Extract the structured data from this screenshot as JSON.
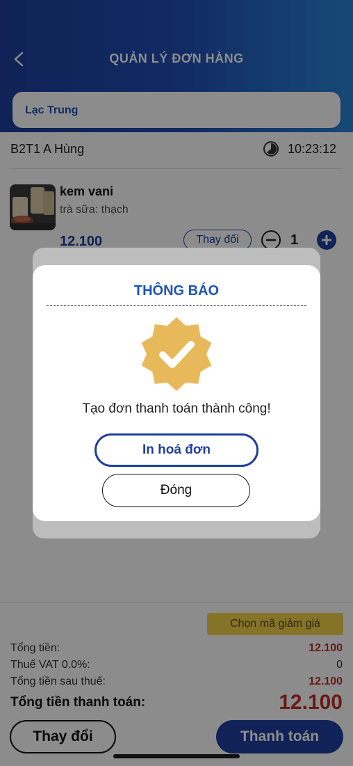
{
  "header": {
    "title": "QUẢN LÝ ĐƠN HÀNG"
  },
  "store": {
    "name": "Lạc Trung"
  },
  "order": {
    "table": "B2T1  A Hùng",
    "time": "10:23:12"
  },
  "item": {
    "name": "kem vani",
    "option": "trà sữa: thạch",
    "price": "12.100",
    "change_label": "Thay đổi",
    "quantity": "1"
  },
  "summary": {
    "discount_label": "Chọn mã giảm giá",
    "total_label": "Tổng tiền:",
    "total_value": "12.100",
    "vat_label": "Thuế VAT 0.0%:",
    "vat_value": "0",
    "after_tax_label": "Tổng tiền sau thuế:",
    "after_tax_value": "12.100",
    "grand_label": "Tổng tiền thanh toán:",
    "grand_value": "12.100",
    "change_button": "Thay đổi",
    "pay_button": "Thanh toán"
  },
  "dialog": {
    "title": "THÔNG BÁO",
    "message": "Tạo đơn thanh toán thành công!",
    "print_button": "In hoá đơn",
    "close_button": "Đóng",
    "badge_icon": "check-badge-icon",
    "badge_color": "#e8b95a"
  },
  "colors": {
    "primary": "#1e3f9e",
    "accent_red": "#c0302a",
    "discount_bg": "#f2d24a"
  }
}
